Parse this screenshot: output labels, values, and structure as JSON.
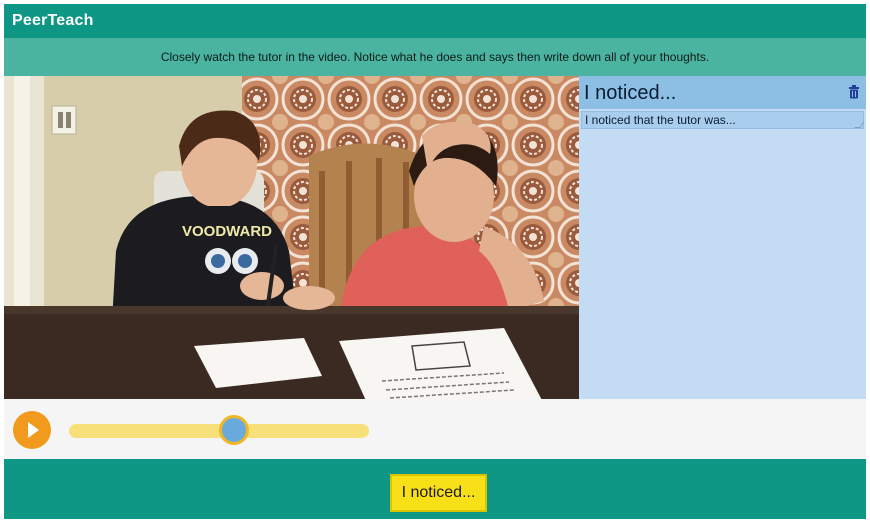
{
  "header": {
    "title": "PeerTeach"
  },
  "instruction": {
    "text": "Closely watch the tutor in the video. Notice what he does and says then write down all of your thoughts."
  },
  "video": {
    "description_icon": "video-frame",
    "shirt_text": "VOODWARD"
  },
  "notes": {
    "title": "I noticed...",
    "delete_icon": "trash-icon",
    "field_value": "I noticed that the tutor was..."
  },
  "player": {
    "play_icon": "play-icon",
    "progress": 0.55
  },
  "footer": {
    "notice_button_label": "I noticed..."
  },
  "colors": {
    "brand": "#0d9784",
    "instruction_bar": "#4bb4a0",
    "notes_panel": "#c3dcf3",
    "notes_header": "#8dbfe4",
    "play_button": "#f29a1e",
    "track": "#f7e07a",
    "thumb": "#6aa9dc",
    "notice_button": "#f8e019"
  }
}
